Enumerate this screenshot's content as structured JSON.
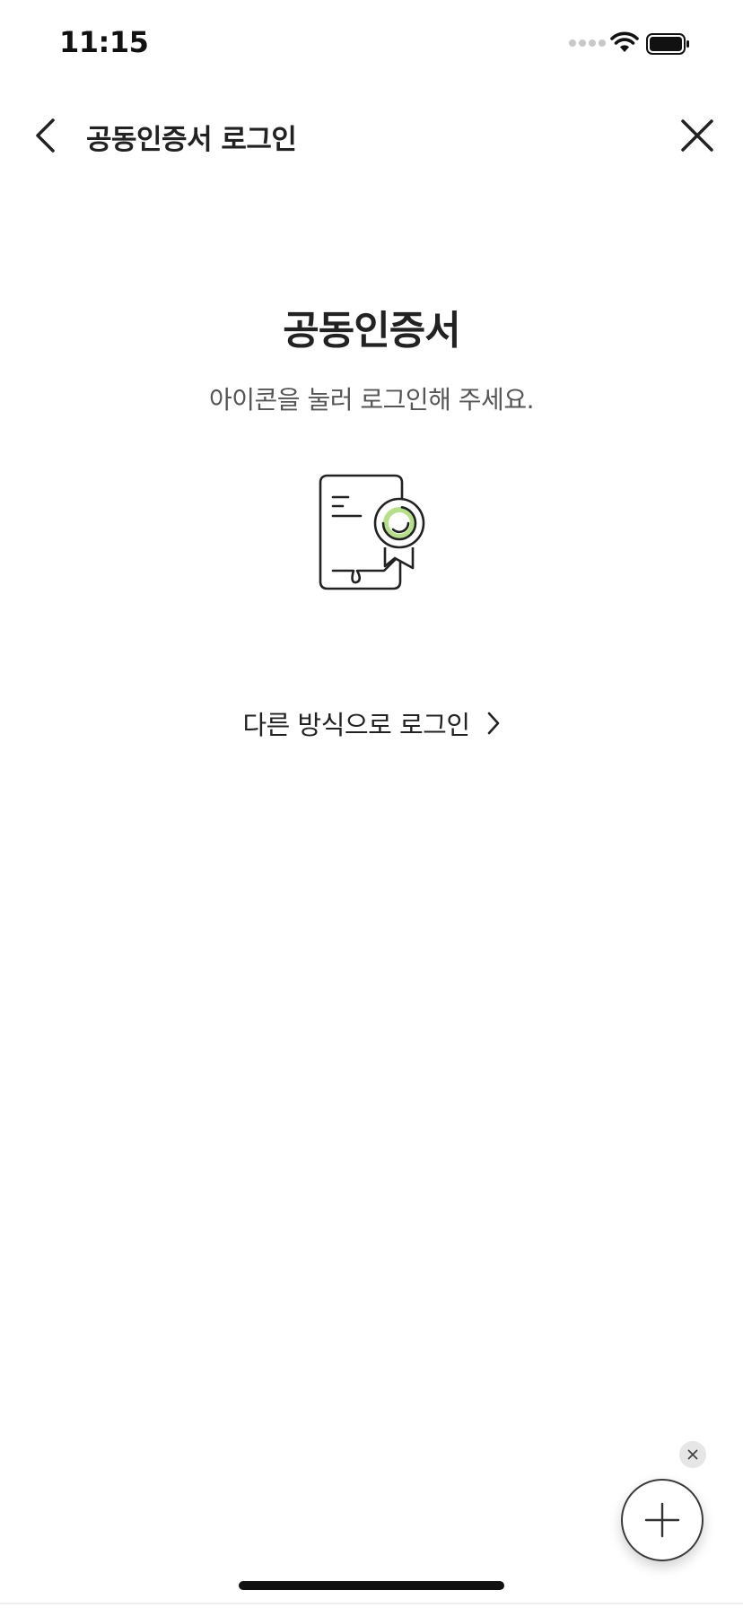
{
  "status_bar": {
    "time": "11:15",
    "icons": [
      "signal-dots-icon",
      "wifi-icon",
      "battery-icon"
    ]
  },
  "nav": {
    "title": "공동인증서 로그인",
    "back_icon": "chevron-left-icon",
    "close_icon": "close-icon"
  },
  "main": {
    "title": "공동인증서",
    "subtitle": "아이콘을 눌러 로그인해 주세요.",
    "certificate_icon": "certificate-icon",
    "alt_login_label": "다른 방식으로 로그인",
    "alt_login_icon": "chevron-right-icon"
  },
  "floating": {
    "dismiss_icon": "close-icon",
    "fab_icon": "plus-icon"
  },
  "colors": {
    "accent": "#b5e089",
    "text": "#222222",
    "subtext": "#555555",
    "icon_stroke": "#222222"
  }
}
